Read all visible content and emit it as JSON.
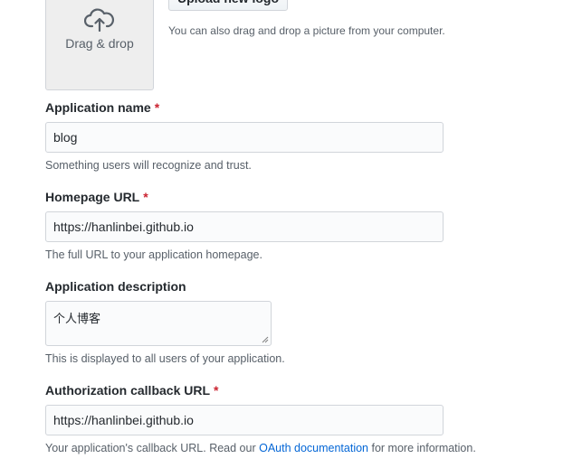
{
  "logo": {
    "drag_drop_label": "Drag & drop",
    "upload_button_label": "Upload new logo",
    "upload_note": "You can also drag and drop a picture from your computer."
  },
  "form": {
    "required_marker": "*",
    "app_name": {
      "label": "Application name",
      "value": "blog",
      "note": "Something users will recognize and trust."
    },
    "homepage_url": {
      "label": "Homepage URL",
      "value": "https://hanlinbei.github.io",
      "note": "The full URL to your application homepage."
    },
    "description": {
      "label": "Application description",
      "value": "个人博客",
      "note": "This is displayed to all users of your application."
    },
    "callback_url": {
      "label": "Authorization callback URL",
      "value": "https://hanlinbei.github.io",
      "note_prefix": "Your application's callback URL. Read our ",
      "note_link": "OAuth documentation",
      "note_suffix": " for more information."
    }
  },
  "colors": {
    "required": "#cb2431",
    "link": "#0366d6",
    "muted_text": "#586069",
    "input_border": "#d1d5da"
  }
}
